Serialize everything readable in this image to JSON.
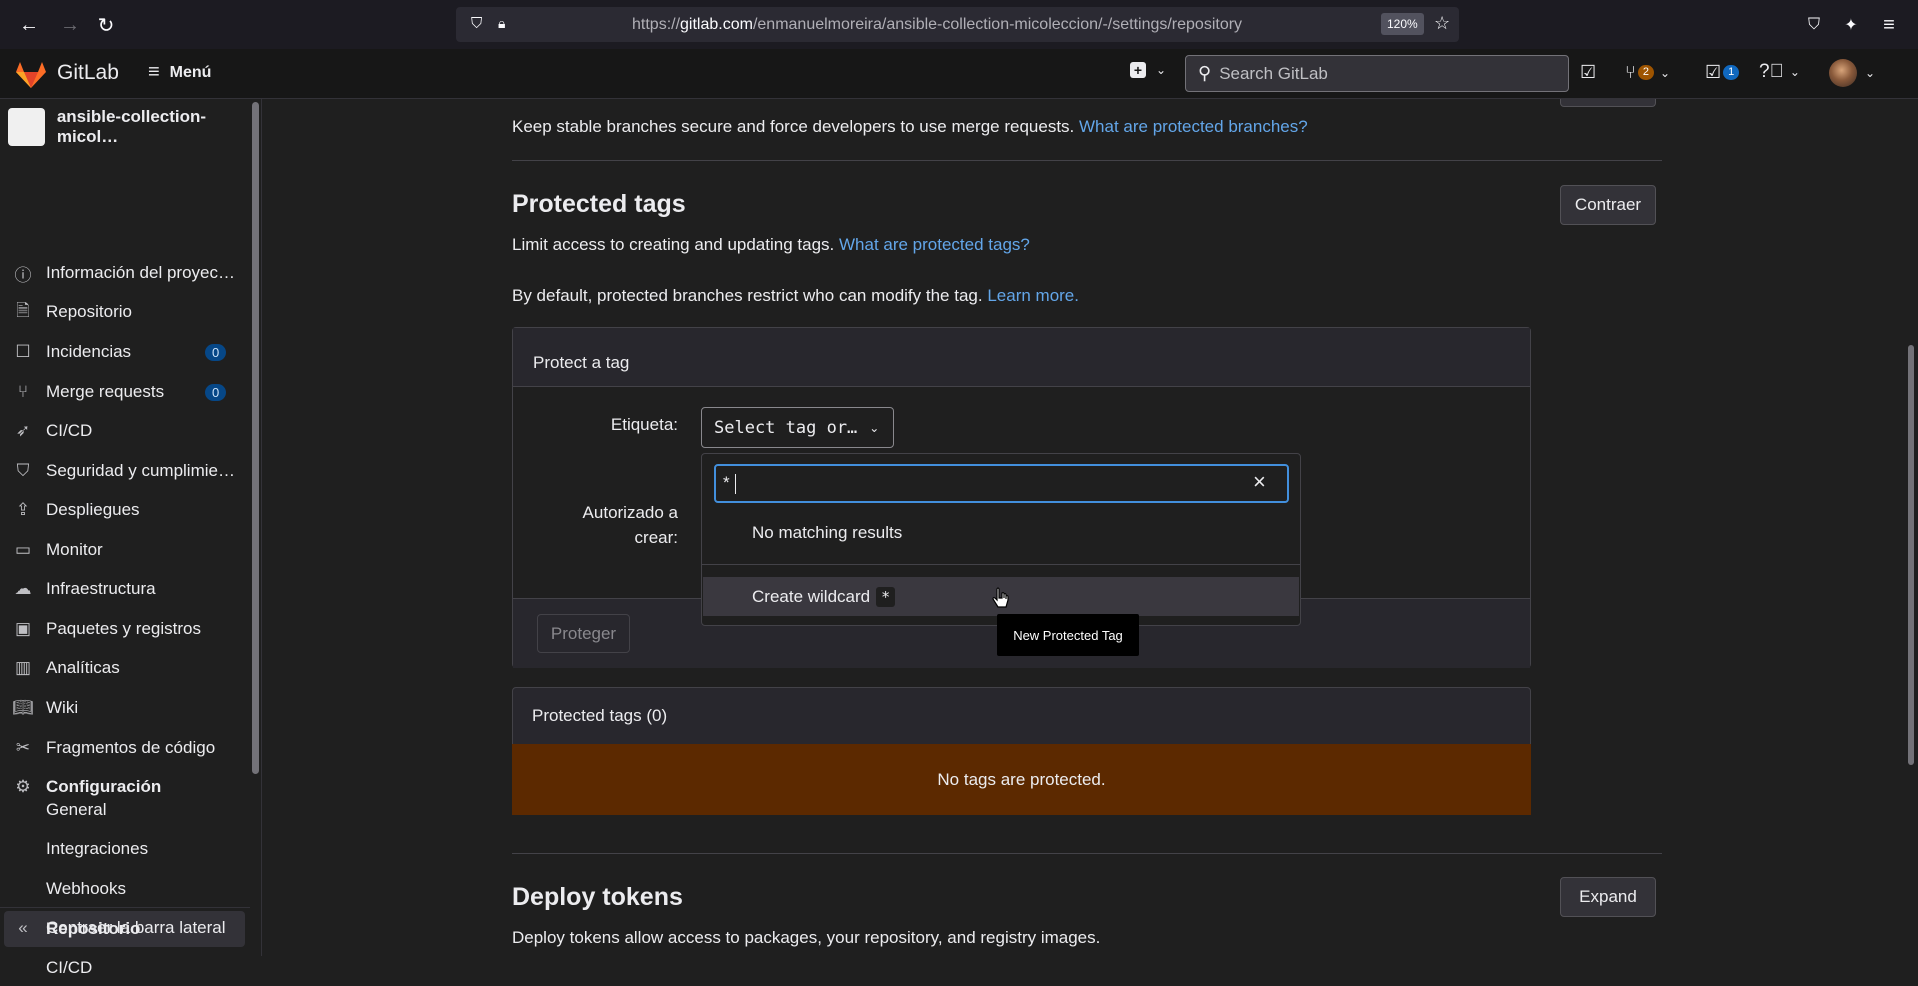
{
  "browser": {
    "url_domain": "gitlab.com",
    "url_prefix": "https://",
    "url_path": "/enmanuelmoreira/ansible-collection-micoleccion/-/settings/repository",
    "zoom": "120%"
  },
  "header": {
    "logo_text": "GitLab",
    "menu_label": "Menú",
    "search_placeholder": "Search GitLab",
    "mr_count": "2",
    "todo_count": "1"
  },
  "sidebar": {
    "project_name": "ansible-collection-micol…",
    "items": [
      {
        "label": "Información del proyec…",
        "icon": "info"
      },
      {
        "label": "Repositorio",
        "icon": "doc"
      },
      {
        "label": "Incidencias",
        "icon": "issues",
        "count": "0"
      },
      {
        "label": "Merge requests",
        "icon": "merge",
        "count": "0"
      },
      {
        "label": "CI/CD",
        "icon": "rocket"
      },
      {
        "label": "Seguridad y cumplimie…",
        "icon": "shield"
      },
      {
        "label": "Despliegues",
        "icon": "deploy"
      },
      {
        "label": "Monitor",
        "icon": "monitor"
      },
      {
        "label": "Infraestructura",
        "icon": "cloud"
      },
      {
        "label": "Paquetes y registros",
        "icon": "package"
      },
      {
        "label": "Analíticas",
        "icon": "chart"
      },
      {
        "label": "Wiki",
        "icon": "book"
      },
      {
        "label": "Fragmentos de código",
        "icon": "snippet"
      },
      {
        "label": "Configuración",
        "icon": "gear"
      }
    ],
    "subitems": [
      "General",
      "Integraciones",
      "Webhooks",
      "Repositorio",
      "CI/CD"
    ],
    "collapse_label": "Contraer la barra lateral"
  },
  "main": {
    "branches_desc": "Keep stable branches secure and force developers to use merge requests.",
    "branches_link": "What are protected branches?",
    "tags_title": "Protected tags",
    "tags_collapse": "Contraer",
    "tags_desc": "Limit access to creating and updating tags.",
    "tags_link": "What are protected tags?",
    "tags_default": "By default, protected branches restrict who can modify the tag.",
    "learn_more": "Learn more.",
    "card_title": "Protect a tag",
    "tag_label": "Etiqueta:",
    "tag_select": "Select tag or…",
    "auth_label_1": "Autorizado a",
    "auth_label_2": "crear:",
    "protect_button": "Proteger",
    "dropdown": {
      "search_value": "*",
      "no_results": "No matching results",
      "create_label": "Create wildcard",
      "create_value": "*"
    },
    "tooltip": "New Protected Tag",
    "table_title": "Protected tags (0)",
    "table_empty": "No tags are protected.",
    "deploy_title": "Deploy tokens",
    "deploy_expand": "Expand",
    "deploy_desc": "Deploy tokens allow access to packages, your repository, and registry images."
  }
}
